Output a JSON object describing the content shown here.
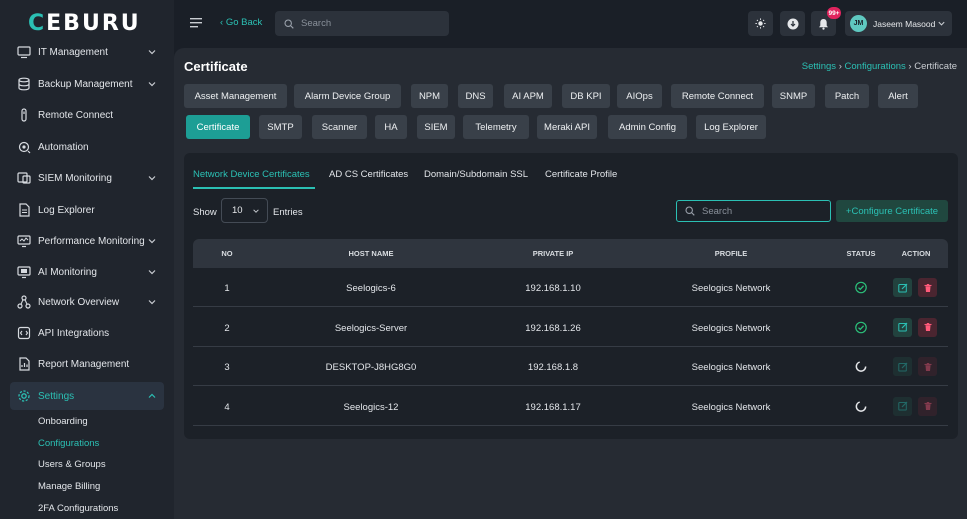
{
  "app": {
    "logo_main": "CEBURU"
  },
  "sidebar": {
    "items": [
      {
        "label": "IT Management",
        "icon": "it-management-icon",
        "expandable": true
      },
      {
        "label": "Backup Management",
        "icon": "backup-icon",
        "expandable": true
      },
      {
        "label": "Remote Connect",
        "icon": "remote-connect-icon",
        "expandable": false
      },
      {
        "label": "Automation",
        "icon": "automation-icon",
        "expandable": false
      },
      {
        "label": "SIEM Monitoring",
        "icon": "siem-icon",
        "expandable": true
      },
      {
        "label": "Log Explorer",
        "icon": "document-icon",
        "expandable": false
      },
      {
        "label": "Performance Monitoring",
        "icon": "monitor-icon",
        "expandable": true
      },
      {
        "label": "AI Monitoring",
        "icon": "ai-monitor-icon",
        "expandable": true
      },
      {
        "label": "Network Overview",
        "icon": "network-icon",
        "expandable": true
      },
      {
        "label": "API Integrations",
        "icon": "api-icon",
        "expandable": false
      },
      {
        "label": "Report Management",
        "icon": "report-icon",
        "expandable": false
      },
      {
        "label": "Settings",
        "icon": "gear-icon",
        "expandable": true,
        "active": true
      }
    ],
    "sub_items": [
      {
        "label": "Onboarding"
      },
      {
        "label": "Configurations",
        "active": true
      },
      {
        "label": "Users & Groups"
      },
      {
        "label": "Manage Billing"
      },
      {
        "label": "2FA Configurations"
      }
    ]
  },
  "topbar": {
    "go_back": "Go Back",
    "search_placeholder": "Search",
    "notification_count": "99+",
    "user_initials": "JM",
    "user_name": "Jaseem Masood"
  },
  "page": {
    "title": "Certificate",
    "breadcrumb": [
      "Settings",
      "Configurations",
      "Certificate"
    ],
    "chips_row1": [
      "Asset Management",
      "Alarm Device Group",
      "NPM",
      "DNS",
      "AI APM",
      "DB KPI",
      "AIOps",
      "Remote Connect",
      "SNMP",
      "Patch",
      "Alert"
    ],
    "chips_row2": [
      "Certificate",
      "SMTP",
      "Scanner",
      "HA",
      "SIEM",
      "Telemetry",
      "Meraki API",
      "Admin Config",
      "Log Explorer"
    ],
    "active_chip": "Certificate"
  },
  "card": {
    "tabs": [
      "Network Device Certificates",
      "AD CS Certificates",
      "Domain/Subdomain SSL",
      "Certificate Profile"
    ],
    "active_tab": "Network Device Certificates",
    "show_label": "Show",
    "entries_value": "10",
    "entries_label": "Entries",
    "search_placeholder": "Search",
    "configure_button": "Configure Certificate",
    "columns": [
      "NO",
      "HOST NAME",
      "PRIVATE IP",
      "PROFILE",
      "STATUS",
      "ACTION"
    ],
    "rows": [
      {
        "no": "1",
        "host": "Seelogics-6",
        "ip": "192.168.1.10",
        "profile": "Seelogics Network",
        "status": "ok"
      },
      {
        "no": "2",
        "host": "Seelogics-Server",
        "ip": "192.168.1.26",
        "profile": "Seelogics Network",
        "status": "ok"
      },
      {
        "no": "3",
        "host": "DESKTOP-J8HG8G0",
        "ip": "192.168.1.8",
        "profile": "Seelogics Network",
        "status": "loading"
      },
      {
        "no": "4",
        "host": "Seelogics-12",
        "ip": "192.168.1.17",
        "profile": "Seelogics Network",
        "status": "loading"
      }
    ]
  },
  "colors": {
    "accent": "#2bc0b4",
    "sidebar_bg": "#20252d",
    "content_bg": "#262b33",
    "danger": "#e0245e"
  }
}
